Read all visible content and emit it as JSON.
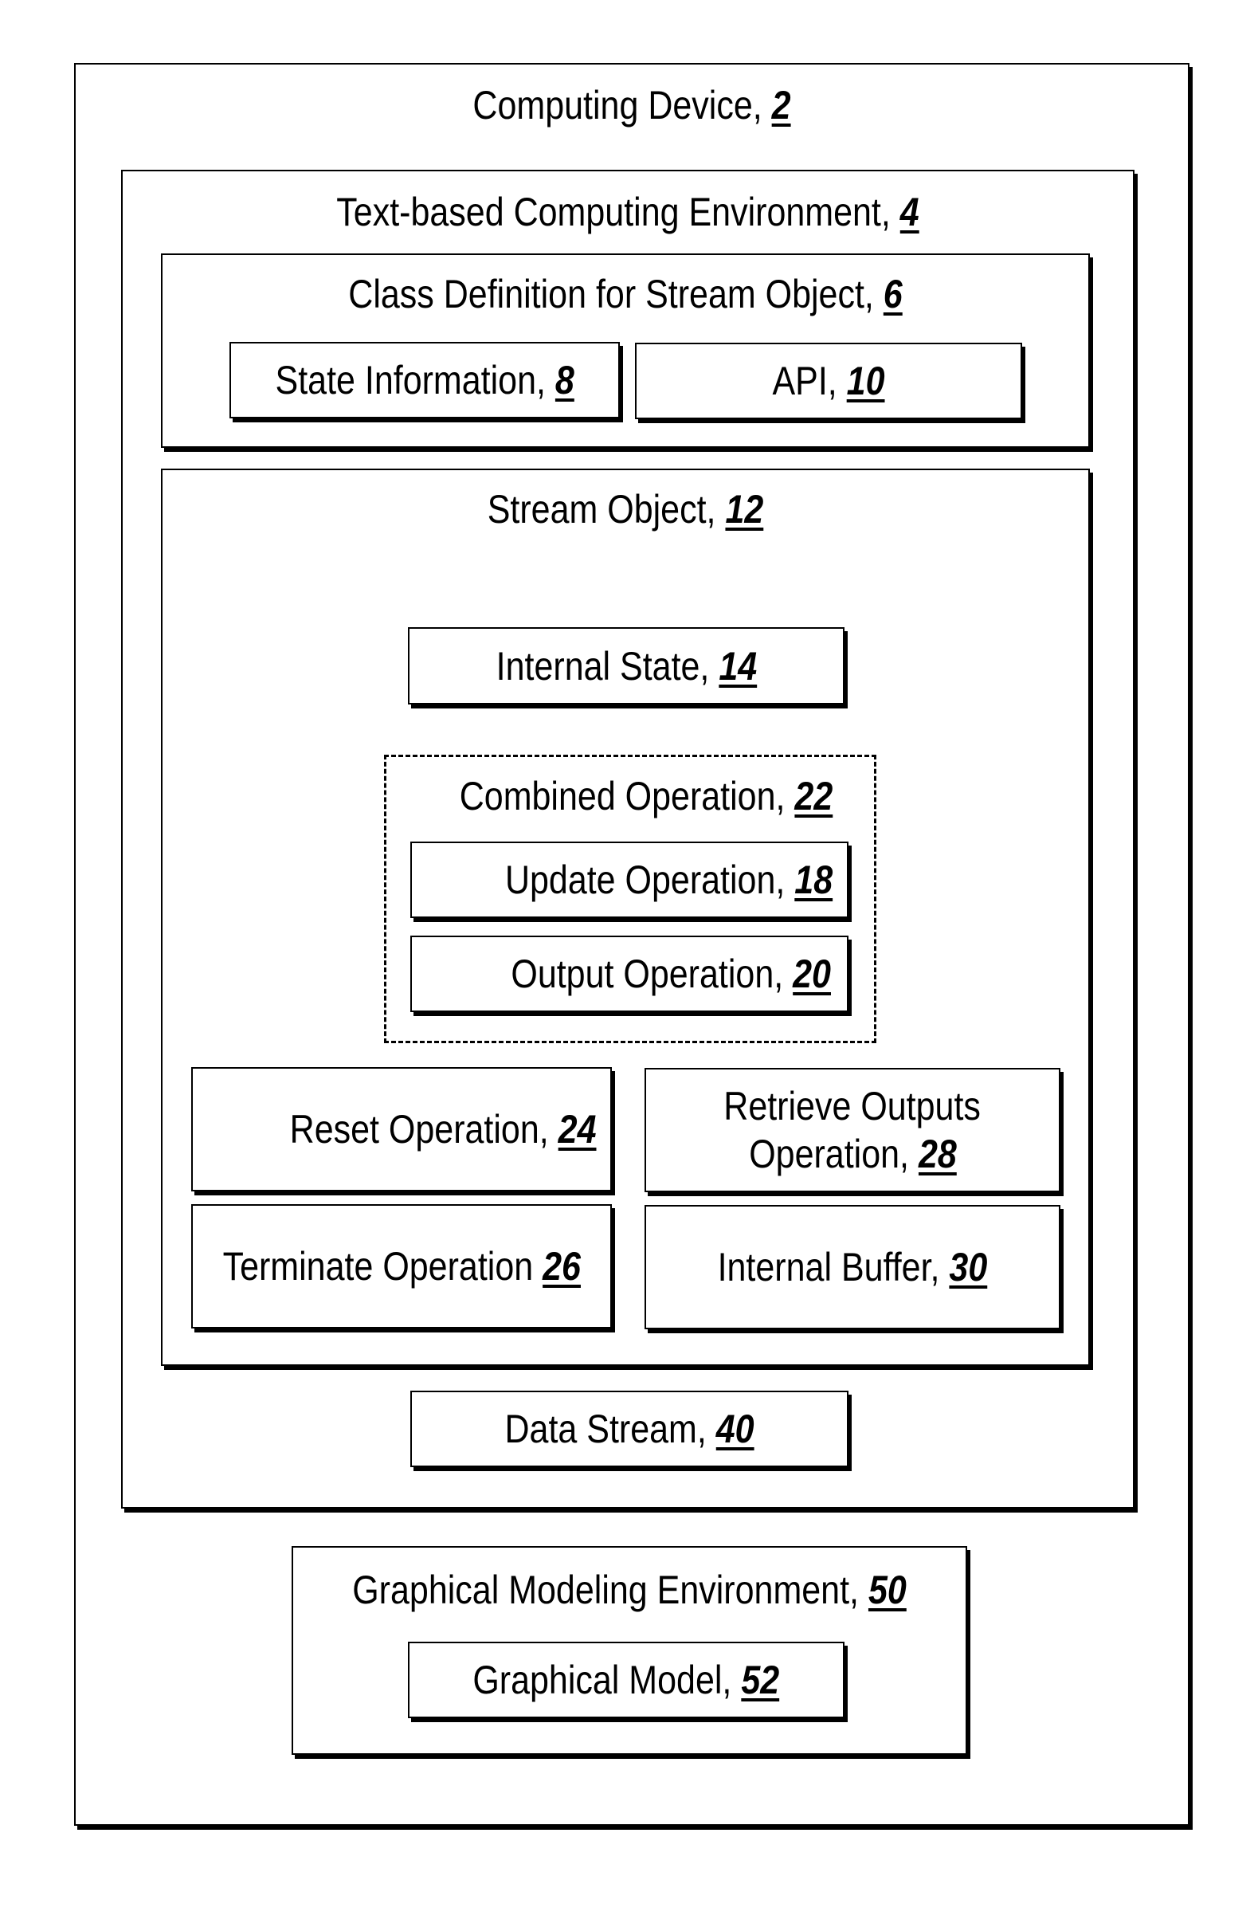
{
  "diagram": {
    "computing_device": {
      "label": "Computing Device, ",
      "ref": "2"
    },
    "text_env": {
      "label": "Text-based Computing Environment, ",
      "ref": "4"
    },
    "class_def": {
      "label": "Class Definition for Stream Object, ",
      "ref": "6"
    },
    "state_info": {
      "label": "State Information, ",
      "ref": "8"
    },
    "api": {
      "label": "API, ",
      "ref": "10"
    },
    "stream_object": {
      "label": "Stream Object, ",
      "ref": "12"
    },
    "internal_state": {
      "label": "Internal State, ",
      "ref": "14"
    },
    "combined_op": {
      "label": "Combined Operation, ",
      "ref": "22"
    },
    "update_op": {
      "label": "Update Operation, ",
      "ref": "18"
    },
    "output_op": {
      "label": "Output Operation, ",
      "ref": "20"
    },
    "reset_op": {
      "label": "Reset Operation, ",
      "ref": "24"
    },
    "retrieve_op": {
      "label_line1": "Retrieve Outputs",
      "label_line2": "Operation, ",
      "ref": "28"
    },
    "terminate_op": {
      "label": "Terminate Operation ",
      "ref": "26"
    },
    "internal_buffer": {
      "label": "Internal Buffer, ",
      "ref": "30"
    },
    "data_stream": {
      "label": "Data Stream, ",
      "ref": "40"
    },
    "graphical_env": {
      "label": "Graphical Modeling Environment, ",
      "ref": "50"
    },
    "graphical_model": {
      "label": "Graphical Model, ",
      "ref": "52"
    }
  }
}
